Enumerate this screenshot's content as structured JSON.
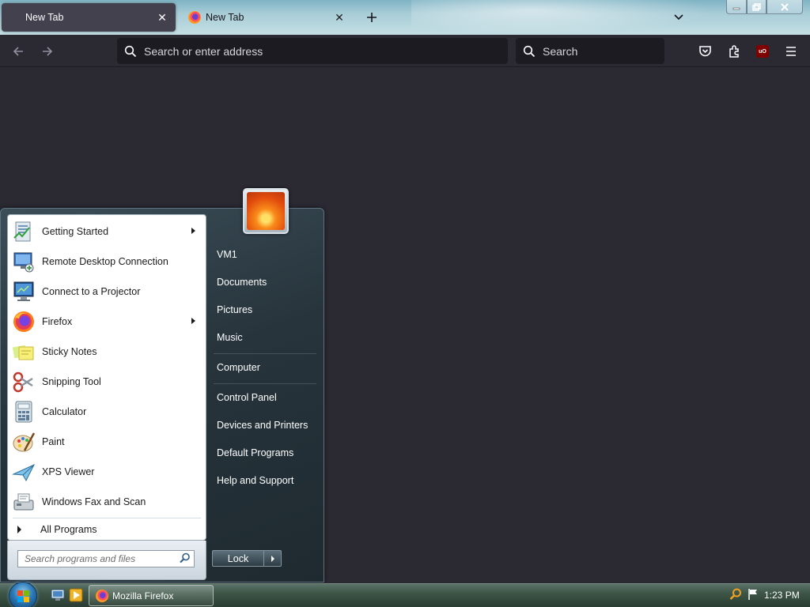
{
  "browser": {
    "tabs": [
      {
        "title": "New Tab",
        "active": false
      },
      {
        "title": "New Tab",
        "active": true
      }
    ],
    "urlbar": {
      "placeholder": "Search or enter address"
    },
    "searchbar": {
      "placeholder": "Search"
    },
    "extension_badge": "uO"
  },
  "start_menu": {
    "programs": [
      {
        "label": "Getting Started",
        "icon": "getting-started-icon",
        "has_submenu": true
      },
      {
        "label": "Remote Desktop Connection",
        "icon": "remote-desktop-icon",
        "has_submenu": false
      },
      {
        "label": "Connect to a Projector",
        "icon": "projector-icon",
        "has_submenu": false
      },
      {
        "label": "Firefox",
        "icon": "firefox-icon",
        "has_submenu": true
      },
      {
        "label": "Sticky Notes",
        "icon": "sticky-notes-icon",
        "has_submenu": false
      },
      {
        "label": "Snipping Tool",
        "icon": "snipping-tool-icon",
        "has_submenu": false
      },
      {
        "label": "Calculator",
        "icon": "calculator-icon",
        "has_submenu": false
      },
      {
        "label": "Paint",
        "icon": "paint-icon",
        "has_submenu": false
      },
      {
        "label": "XPS Viewer",
        "icon": "xps-viewer-icon",
        "has_submenu": false
      },
      {
        "label": "Windows Fax and Scan",
        "icon": "fax-scan-icon",
        "has_submenu": false
      }
    ],
    "all_programs": "All Programs",
    "search_placeholder": "Search programs and files",
    "right_links": [
      "VM1",
      "Documents",
      "Pictures",
      "Music",
      "Computer",
      "Control Panel",
      "Devices and Printers",
      "Default Programs",
      "Help and Support"
    ],
    "lock_label": "Lock"
  },
  "taskbar": {
    "task_label": "Mozilla Firefox",
    "clock": "1:23 PM"
  },
  "colors": {
    "browser_bg": "#2b2a33",
    "urlbar_bg": "#1c1b22",
    "startmenu_left_bg": "#ffffff",
    "taskbar": "#3d5546"
  }
}
